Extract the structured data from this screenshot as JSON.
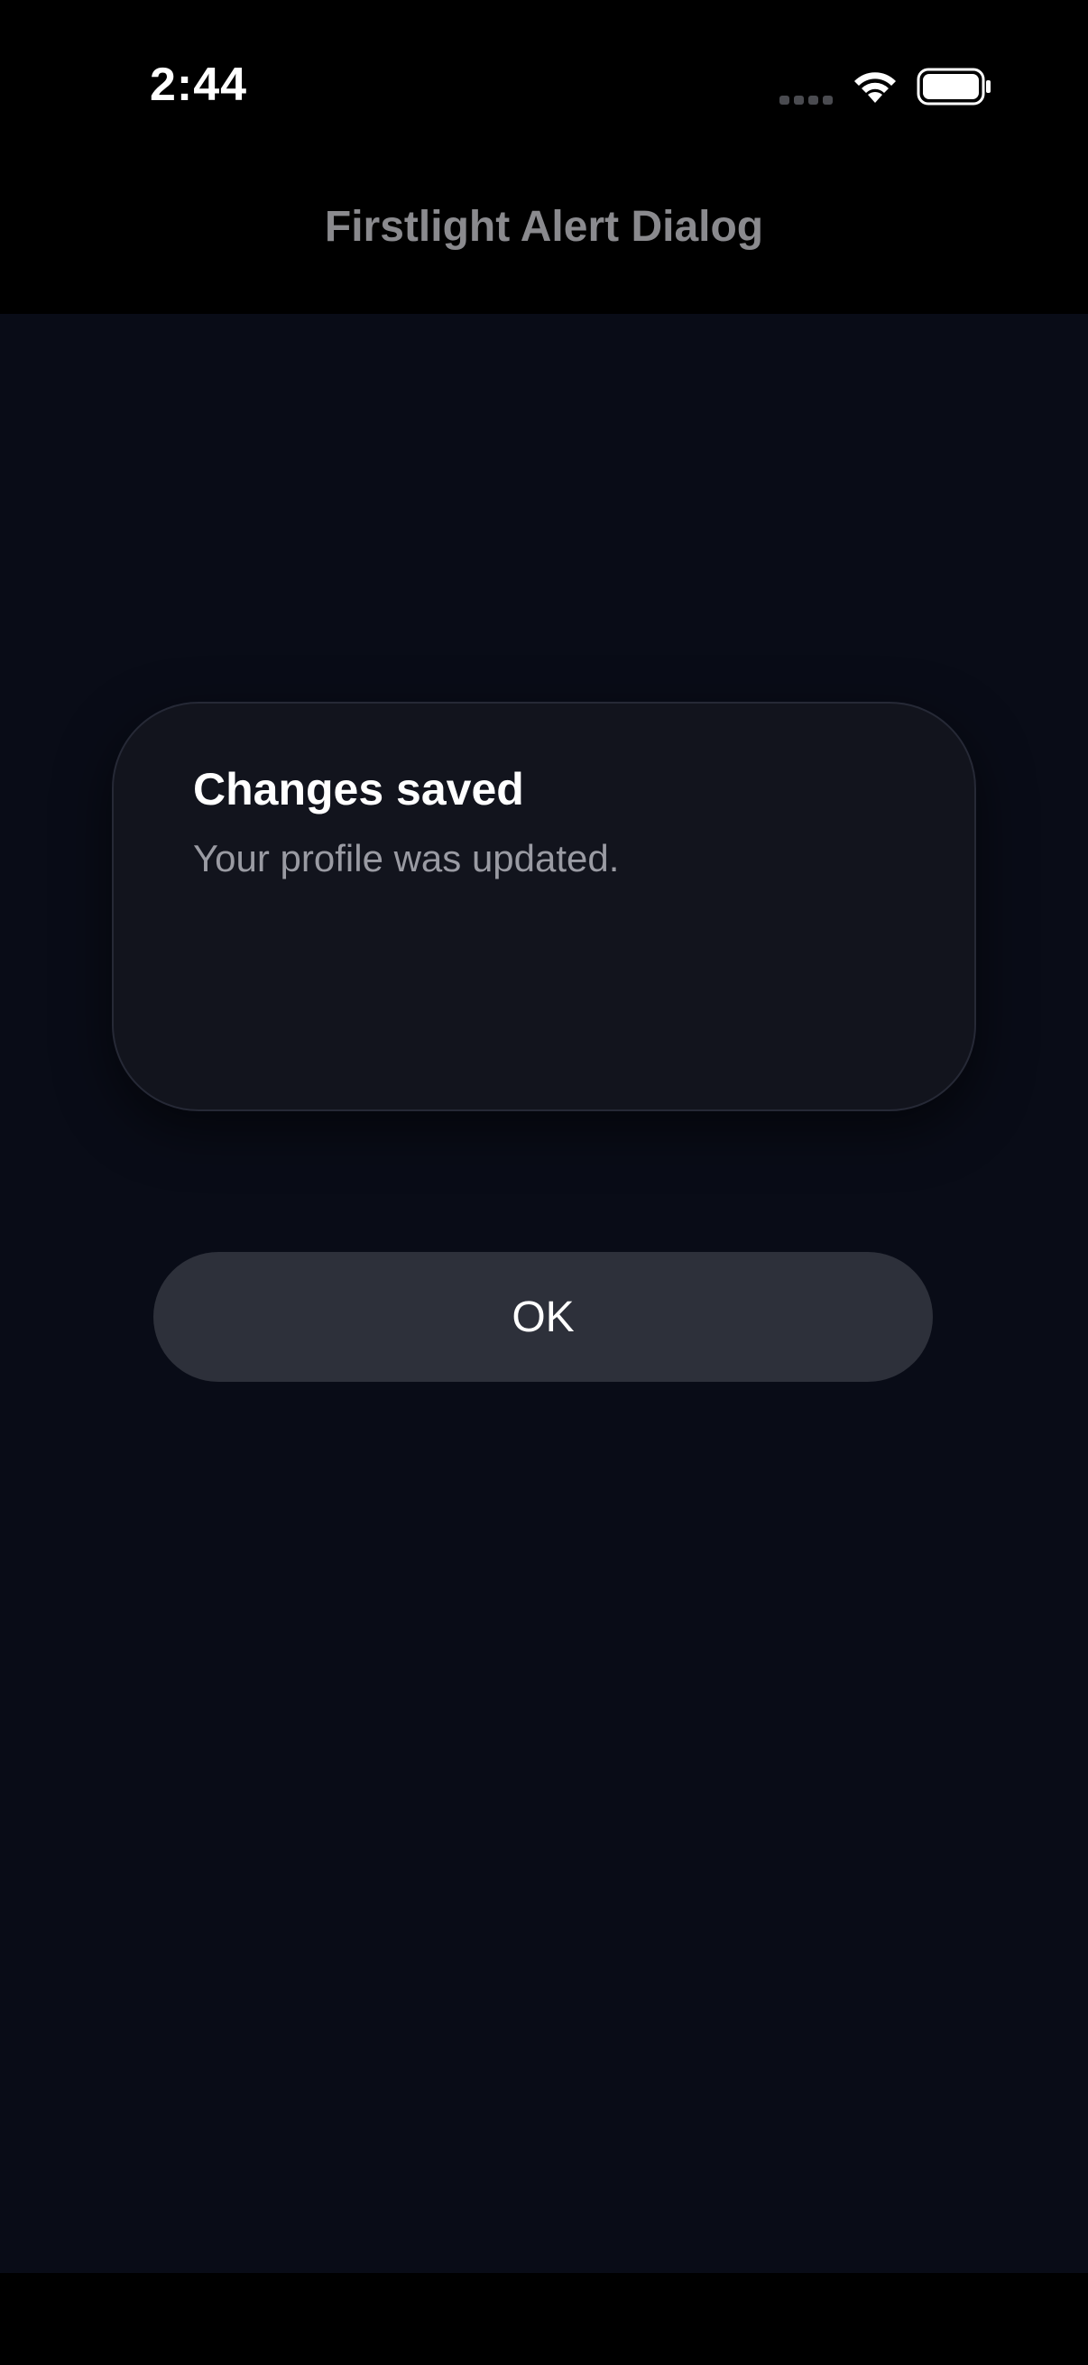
{
  "status_bar": {
    "time": "2:44",
    "signal_icon": "signal-dots-icon",
    "wifi_icon": "wifi-icon",
    "battery_icon": "battery-icon"
  },
  "header": {
    "title": "Firstlight Alert Dialog"
  },
  "dialog": {
    "title": "Changes saved",
    "message": "Your profile was updated.",
    "ok_label": "OK"
  },
  "colors": {
    "background": "#090c17",
    "dialog_surface": "#12141d",
    "button_surface": "#2d303a",
    "title_text": "#ffffff",
    "secondary_text": "#9a9ba3",
    "header_text": "#8a8a8e"
  }
}
